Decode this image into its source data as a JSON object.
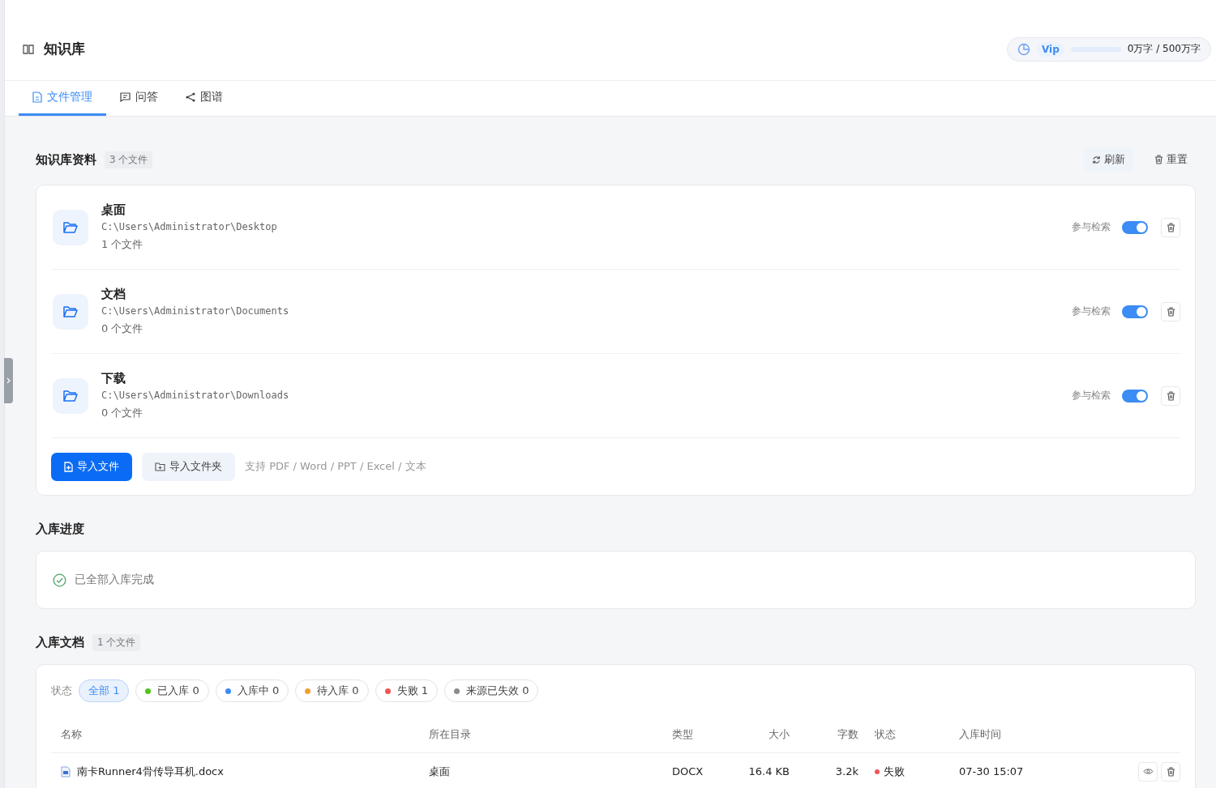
{
  "header": {
    "title": "知识库",
    "plan": "Vip",
    "usage_bar": {
      "level": 0
    },
    "usage": "0万字 / 500万字"
  },
  "tabs": [
    {
      "label": "文件管理",
      "kind": "doc",
      "selected": true
    },
    {
      "label": "问答",
      "kind": "chat",
      "selected": false
    },
    {
      "label": "图谱",
      "kind": "share",
      "selected": false
    }
  ],
  "sources": {
    "title": "知识库资料",
    "count": "3 个文件",
    "refresh": "刷新",
    "reset": "重置",
    "folders": [
      {
        "name": "桌面",
        "path": "C:\\Users\\Administrator\\Desktop",
        "files": "1 个文件",
        "search_label": "参与检索",
        "on": true
      },
      {
        "name": "文档",
        "path": "C:\\Users\\Administrator\\Documents",
        "files": "0 个文件",
        "search_label": "参与检索",
        "on": true
      },
      {
        "name": "下载",
        "path": "C:\\Users\\Administrator\\Downloads",
        "files": "0 个文件",
        "search_label": "参与检索",
        "on": true
      }
    ],
    "import_file": "导入文件",
    "import_folder": "导入文件夹",
    "hint": "支持 PDF / Word / PPT / Excel / 文本"
  },
  "progress": {
    "title": "入库进度",
    "message": "已全部入库完成"
  },
  "documents": {
    "title": "入库文档",
    "count": "1 个文件",
    "filter_label": "状态",
    "filters": [
      {
        "label": "全部 1",
        "selected": true
      },
      {
        "label": "已入库 0",
        "color": "#52c41a",
        "selected": false
      },
      {
        "label": "入库中 0",
        "color": "#3b8cf5",
        "selected": false
      },
      {
        "label": "待入库 0",
        "color": "#f0a030",
        "selected": false
      },
      {
        "label": "失败 1",
        "color": "#f05454",
        "selected": false
      },
      {
        "label": "来源已失效 0",
        "color": "#8c8c8c",
        "selected": false
      }
    ],
    "columns": [
      "名称",
      "所在目录",
      "类型",
      "大小",
      "字数",
      "状态",
      "入库时间"
    ],
    "rows": [
      {
        "name": "南卡Runner4骨传导耳机.docx",
        "dir": "桌面",
        "type": "DOCX",
        "size": "16.4 KB",
        "words": "3.2k",
        "status": "失败",
        "color": "#f05454",
        "time": "07-30 15:07"
      }
    ]
  }
}
